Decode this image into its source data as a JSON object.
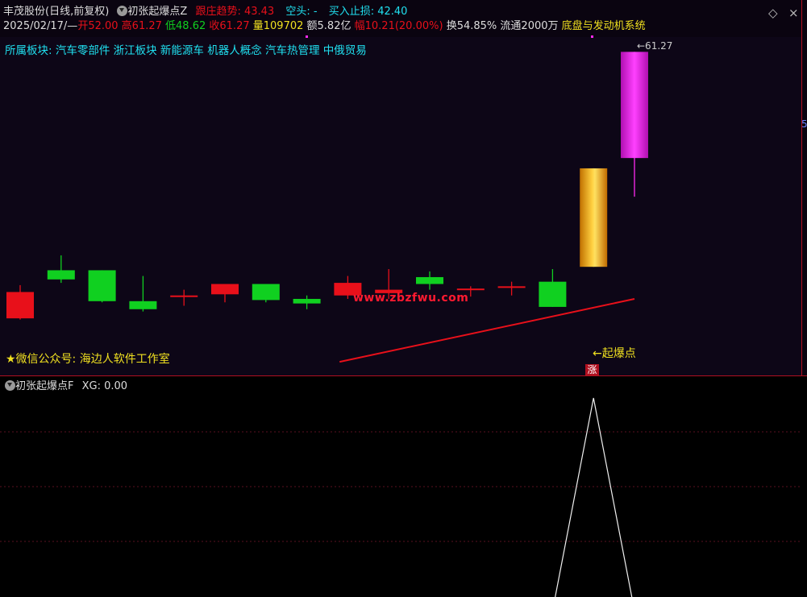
{
  "header": {
    "stock_title": "丰茂股份(日线,前复权)",
    "indicator_name": "初张起爆点Z",
    "trend_label": "跟庄趋势: 43.43",
    "short_label": "空头: -",
    "stop_label": "买入止损: 42.40",
    "date": "2025/02/17/—",
    "open_label": "开52.00",
    "high_label": "高61.27",
    "low_label": "低48.62",
    "close_label": "收61.27",
    "volume_label": "量109702",
    "amount_label": "额5.82亿",
    "change_label": "幅10.21(20.00%)",
    "turnover_label": "换54.85%",
    "float_label": "流通2000万",
    "theme_label": "底盘与发动机系统"
  },
  "sectors": "所属板块: 汽车零部件 浙江板块 新能源车 机器人概念 汽车热管理 中俄贸易",
  "watermark": "www.zbzfwu.com",
  "wechat": "★微信公众号: 海边人软件工作室",
  "signal_label": "←起爆点",
  "limit_badge": "涨",
  "high_price_label": "←61.27",
  "right_edge_digit": "5",
  "sub_panel": {
    "indicator_name": "初张起爆点F",
    "xg_label": "XG: 0.00"
  },
  "colors": {
    "up": "#e8101a",
    "down": "#10d020",
    "limit_up": "#ff2af0",
    "signal": "#ffa500",
    "trend_line": "#e8101a",
    "text_cyan": "#20e0f0",
    "text_yellow": "#f0e020",
    "panel_border": "#b01020"
  },
  "chart_data": {
    "type": "candlestick",
    "note_price_range": [
      34,
      62
    ],
    "candles": [
      {
        "o": 40.3,
        "h": 40.9,
        "l": 37.9,
        "c": 38.0,
        "kind": "up"
      },
      {
        "o": 42.2,
        "h": 43.5,
        "l": 41.1,
        "c": 41.4,
        "kind": "down"
      },
      {
        "o": 42.2,
        "h": 42.2,
        "l": 39.4,
        "c": 39.5,
        "kind": "down"
      },
      {
        "o": 39.5,
        "h": 41.7,
        "l": 38.6,
        "c": 38.8,
        "kind": "down"
      },
      {
        "o": 40.0,
        "h": 40.5,
        "l": 39.1,
        "c": 40.0,
        "kind": "up"
      },
      {
        "o": 40.1,
        "h": 40.9,
        "l": 39.4,
        "c": 41.0,
        "kind": "up"
      },
      {
        "o": 41.0,
        "h": 41.0,
        "l": 39.4,
        "c": 39.6,
        "kind": "down"
      },
      {
        "o": 39.7,
        "h": 40.0,
        "l": 38.8,
        "c": 39.3,
        "kind": "down"
      },
      {
        "o": 40.0,
        "h": 41.7,
        "l": 39.7,
        "c": 41.1,
        "kind": "up"
      },
      {
        "o": 40.2,
        "h": 42.3,
        "l": 39.7,
        "c": 40.5,
        "kind": "up"
      },
      {
        "o": 41.6,
        "h": 42.1,
        "l": 40.5,
        "c": 41.0,
        "kind": "down"
      },
      {
        "o": 40.5,
        "h": 40.8,
        "l": 39.9,
        "c": 40.6,
        "kind": "up"
      },
      {
        "o": 40.7,
        "h": 41.2,
        "l": 40.0,
        "c": 40.8,
        "kind": "up"
      },
      {
        "o": 41.2,
        "h": 42.3,
        "l": 39.0,
        "c": 39.0,
        "kind": "down"
      },
      {
        "o": 42.5,
        "h": 51.1,
        "l": 42.5,
        "c": 51.1,
        "kind": "signal"
      },
      {
        "o": 52.0,
        "h": 61.27,
        "l": 48.62,
        "c": 61.27,
        "kind": "limit_up"
      }
    ],
    "trend_line": [
      [
        7.8,
        34.2
      ],
      [
        15.0,
        39.7
      ]
    ],
    "sub_series": {
      "name": "XG",
      "values": [
        0,
        0,
        0,
        0,
        0,
        0,
        0,
        0,
        0,
        0,
        0,
        0,
        0,
        0,
        1,
        0
      ],
      "range": [
        0,
        1
      ]
    }
  }
}
